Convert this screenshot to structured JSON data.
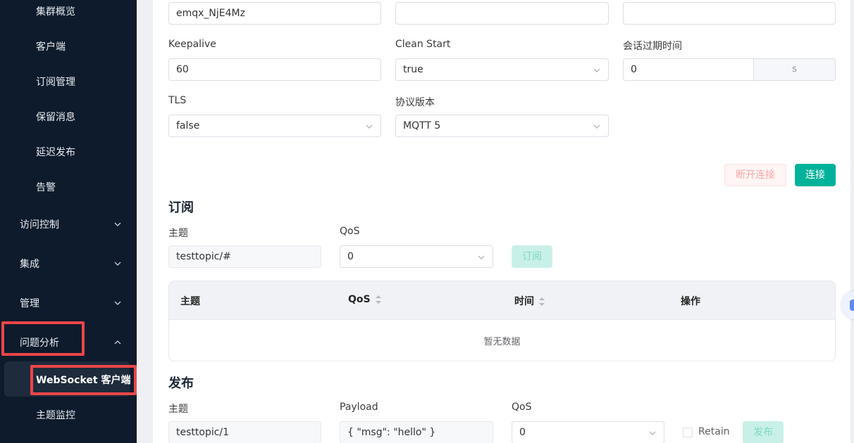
{
  "sidebar": {
    "items": [
      {
        "label": "集群概览"
      },
      {
        "label": "客户端"
      },
      {
        "label": "订阅管理"
      },
      {
        "label": "保留消息"
      },
      {
        "label": "延迟发布"
      },
      {
        "label": "告警"
      }
    ],
    "groups": [
      {
        "label": "访问控制"
      },
      {
        "label": "集成"
      },
      {
        "label": "管理"
      },
      {
        "label": "问题分析"
      }
    ],
    "sub_items": [
      {
        "label": "WebSocket 客户端"
      },
      {
        "label": "主题监控"
      }
    ]
  },
  "connection": {
    "client_id": "emqx_NjE4Mz",
    "username": "",
    "password": "",
    "keepalive_label": "Keepalive",
    "keepalive_value": "60",
    "clean_start_label": "Clean Start",
    "clean_start_value": "true",
    "session_expiry_label": "会话过期时间",
    "session_expiry_value": "0",
    "session_expiry_unit": "s",
    "tls_label": "TLS",
    "tls_value": "false",
    "protocol_label": "协议版本",
    "protocol_value": "MQTT 5",
    "disconnect_label": "断开连接",
    "connect_label": "连接"
  },
  "subscribe": {
    "title": "订阅",
    "topic_label": "主题",
    "topic_value": "testtopic/#",
    "qos_label": "QoS",
    "qos_value": "0",
    "button_label": "订阅",
    "table": {
      "columns": [
        "主题",
        "QoS",
        "时间",
        "操作"
      ],
      "empty_text": "暂无数据"
    }
  },
  "publish": {
    "title": "发布",
    "topic_label": "主题",
    "topic_value": "testtopic/1",
    "payload_label": "Payload",
    "payload_value": "{ \"msg\": \"hello\" }",
    "qos_label": "QoS",
    "qos_value": "0",
    "retain_label": "Retain",
    "button_label": "发布"
  },
  "colors": {
    "sidebar_bg": "#0e1b2c",
    "accent": "#00b299",
    "highlight_box": "#ec4549"
  }
}
